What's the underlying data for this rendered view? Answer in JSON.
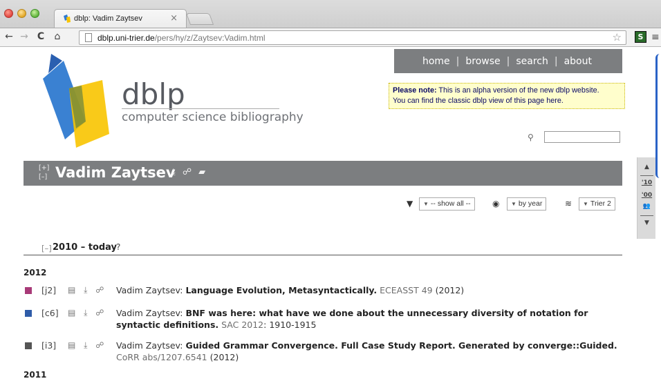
{
  "browser": {
    "tab_title": "dblp: Vadim Zaytsev",
    "tab_close": "×",
    "url_host": "dblp.uni-trier.de",
    "url_path": "/pers/hy/z/Zaytsev:Vadim.html",
    "back": "←",
    "forward": "→",
    "reload": "C",
    "home": "⌂",
    "star": "☆",
    "ext": "S",
    "menu": "≡"
  },
  "nav": {
    "items": [
      "home",
      "browse",
      "search",
      "about"
    ],
    "sep": "|"
  },
  "logo": {
    "title": "dblp",
    "subtitle": "computer science bibliography"
  },
  "note": {
    "label": "Please note:",
    "line1": "This is an alpha version of the new dblp website.",
    "line2": "You can find the classic dblp view of this page here."
  },
  "person": {
    "toggle_expand": "[+]",
    "toggle_collapse": "[–]",
    "name": "Vadim Zaytsev",
    "icons": "⤓ ☍ ▰"
  },
  "controls": {
    "filter_icon": "▼",
    "filter_value": "-- show all --",
    "view_icon": "◉",
    "view_value": "by year",
    "db_icon": "≋",
    "db_value": "Trier 2",
    "caret": "▼"
  },
  "section": {
    "toggle": "[–]",
    "title": "2010 – today",
    "help": "?"
  },
  "years": [
    "2012",
    "2011"
  ],
  "entries": [
    {
      "key": "[j2]",
      "color": "#a83a78",
      "actions": "▤ ⤓ ☍",
      "author": "Vadim Zaytsev:",
      "title": "Language Evolution, Metasyntactically.",
      "venue": "ECEASST 49",
      "rest": "(2012)"
    },
    {
      "key": "[c6]",
      "color": "#2f5ca8",
      "actions": "▤ ⤓ ☍",
      "author": "Vadim Zaytsev:",
      "title": "BNF was here: what have we done about the unnecessary diversity of notation for syntactic definitions.",
      "venue": "SAC 2012",
      "rest": ": 1910-1915"
    },
    {
      "key": "[i3]",
      "color": "#555555",
      "actions": "▤ ⤓ ☍",
      "author": "Vadim Zaytsev:",
      "title": "Guided Grammar Convergence. Full Case Study Report. Generated by converge::Guided.",
      "venue": "CoRR abs/1207.6541",
      "rest": "(2012)"
    }
  ],
  "sidebar": {
    "top": "▲",
    "y10": "'10",
    "y00": "'00",
    "coauthors": "👥",
    "bottom": "▼"
  },
  "colors": {
    "nav_bg": "#7c7e80",
    "note_bg": "#fffecc",
    "logo_blue": "#2f7ad0",
    "logo_yellow": "#f8c400"
  }
}
